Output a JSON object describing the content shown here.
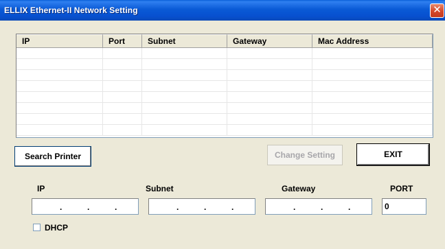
{
  "window": {
    "title": "ELLIX Ethernet-II Network Setting",
    "close_glyph": "✕"
  },
  "table": {
    "columns": [
      "IP",
      "Port",
      "Subnet",
      "Gateway",
      "Mac Address"
    ],
    "rows": []
  },
  "buttons": {
    "search": "Search Printer",
    "change": "Change Setting",
    "exit": "EXIT"
  },
  "fields": {
    "ip": {
      "label": "IP",
      "value": ".   .   ."
    },
    "subnet": {
      "label": "Subnet",
      "value": ".   .   ."
    },
    "gateway": {
      "label": "Gateway",
      "value": ".   .   ."
    },
    "port": {
      "label": "PORT",
      "value": "0"
    }
  },
  "dhcp": {
    "label": "DHCP",
    "checked": false
  }
}
